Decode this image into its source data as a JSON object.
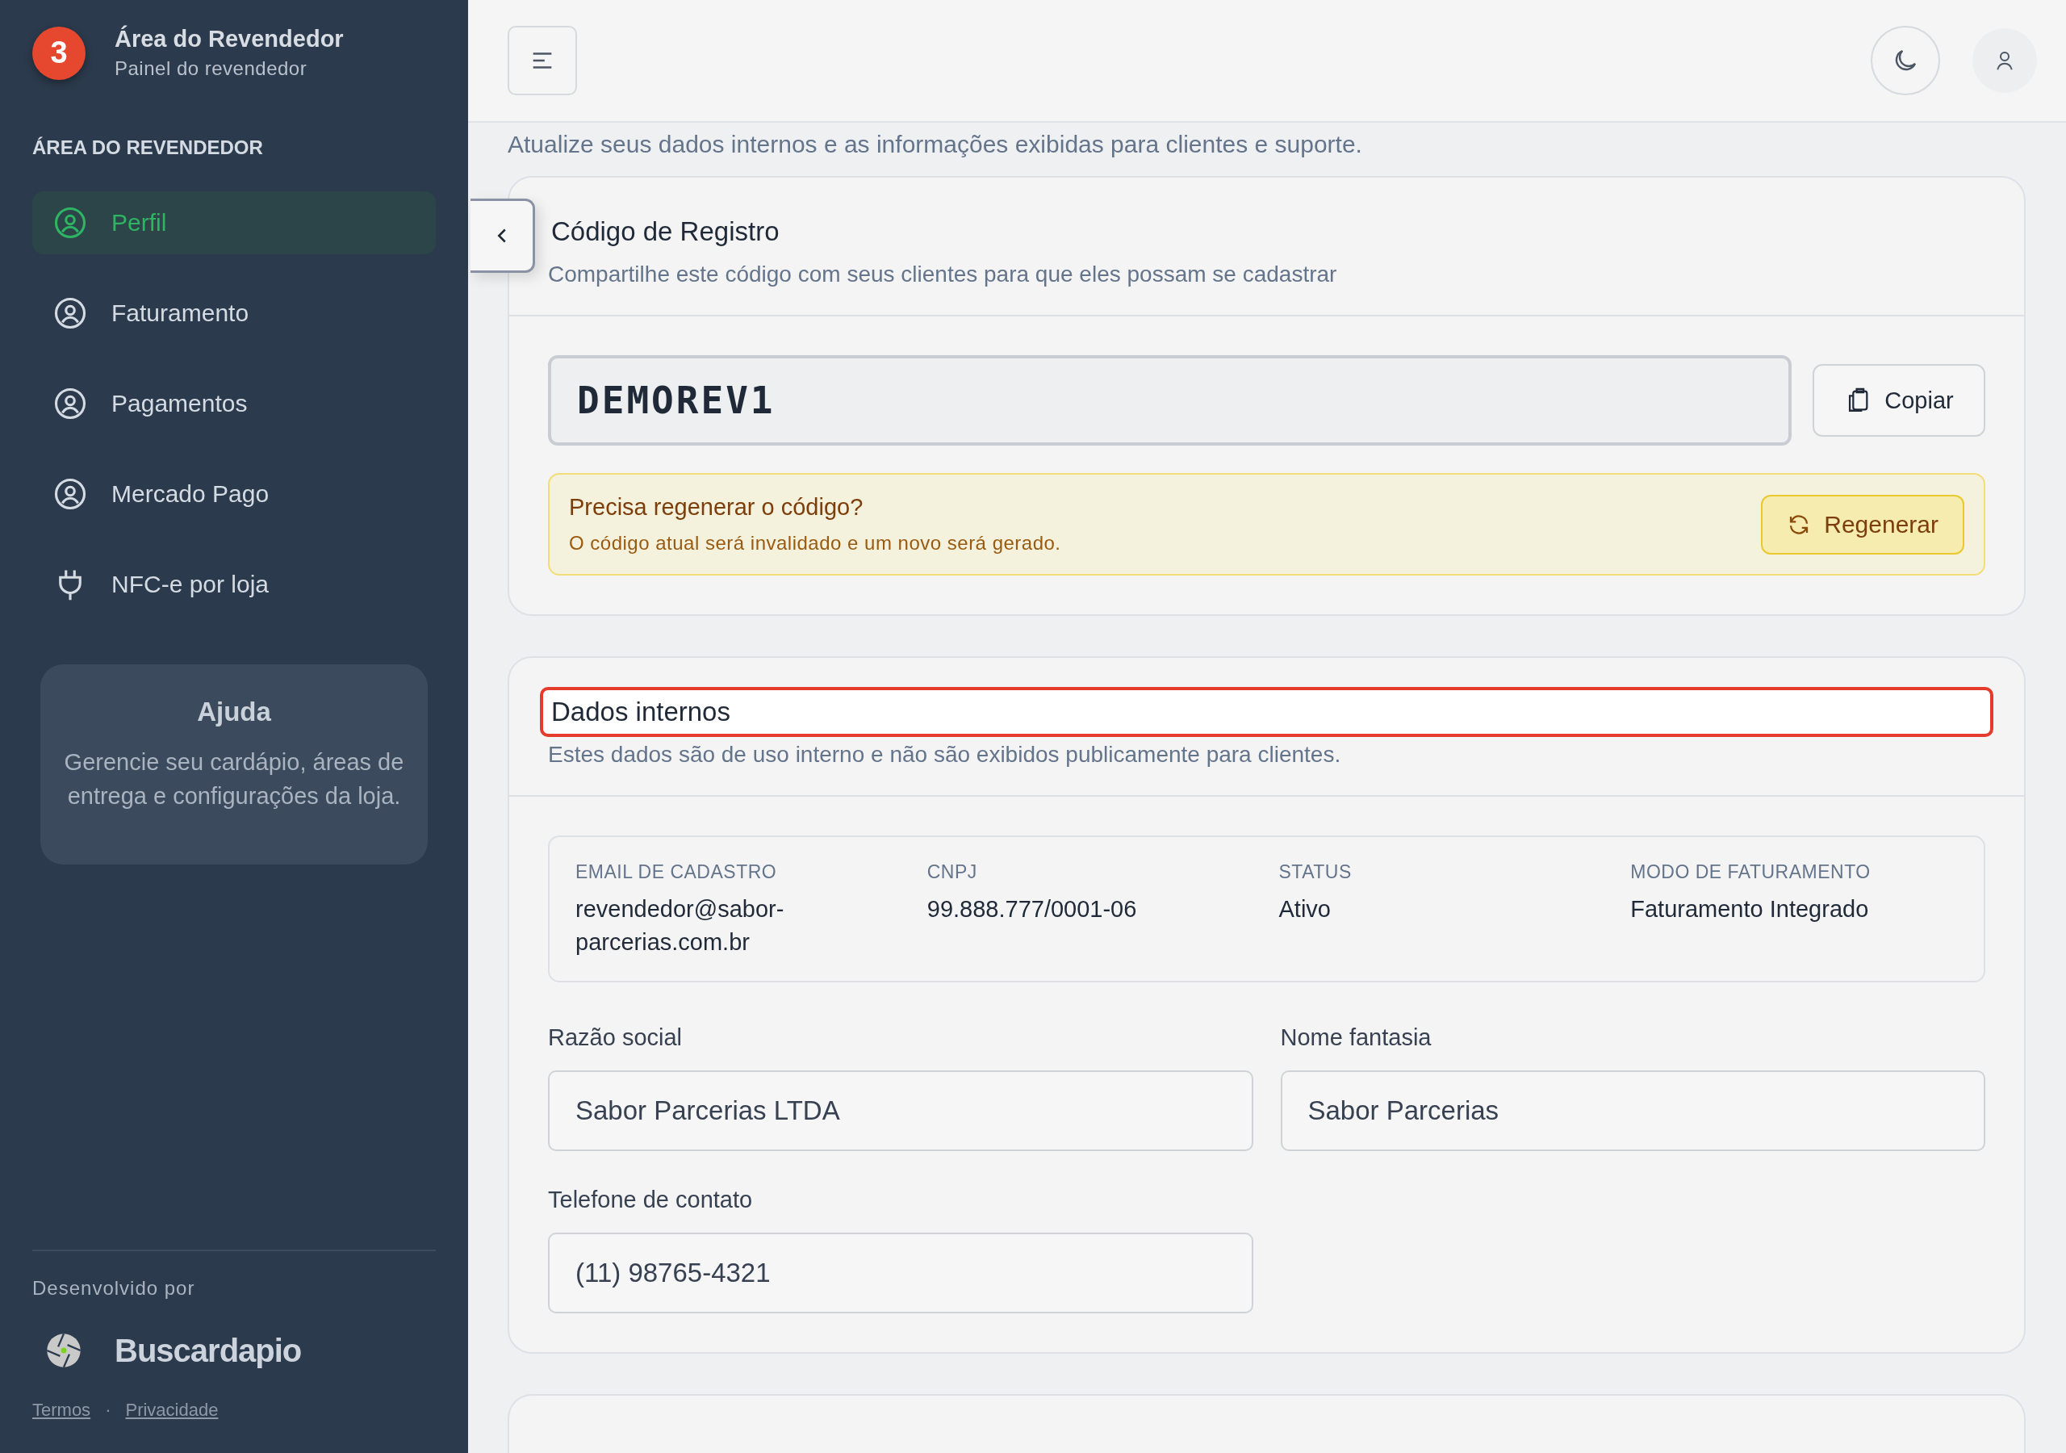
{
  "sidebar": {
    "badge": "3",
    "brand_title": "Área do Revendedor",
    "brand_subtitle": "Painel do revendedor",
    "section_label": "ÁREA DO REVENDEDOR",
    "items": [
      {
        "label": "Perfil",
        "kind": "user",
        "selected": true
      },
      {
        "label": "Faturamento",
        "kind": "user",
        "selected": false
      },
      {
        "label": "Pagamentos",
        "kind": "user",
        "selected": false
      },
      {
        "label": "Mercado Pago",
        "kind": "user",
        "selected": false
      },
      {
        "label": "NFC-e por loja",
        "kind": "plug",
        "selected": false
      }
    ],
    "help": {
      "title": "Ajuda",
      "text": "Gerencie seu cardápio, áreas de entrega e configurações da loja."
    },
    "footer": {
      "credit": "Desenvolvido por",
      "logo_text": "Buscardapio",
      "links": [
        "Termos",
        "Privacidade"
      ],
      "separator": "·"
    }
  },
  "page_subtitle": "Atualize seus dados internos e as informações exibidas para clientes e suporte.",
  "registration_card": {
    "title": "Código de Registro",
    "subtitle": "Compartilhe este código com seus clientes para que eles possam se cadastrar",
    "code": "DEMOREV1",
    "copy_button": "Copiar",
    "notice": {
      "title": "Precisa regenerar o código?",
      "text": "O código atual será invalidado e um novo será gerado.",
      "button": "Regenerar"
    }
  },
  "internal_card": {
    "title": "Dados internos",
    "highlighted": true,
    "subtitle": "Estes dados são de uso interno e não são exibidos publicamente para clientes.",
    "info": [
      {
        "label": "EMAIL DE CADASTRO",
        "value": "revendedor@sabor-parcerias.com.br"
      },
      {
        "label": "CNPJ",
        "value": "99.888.777/0001-06"
      },
      {
        "label": "STATUS",
        "value": "Ativo"
      },
      {
        "label": "MODO DE FATURAMENTO",
        "value": "Faturamento Integrado"
      }
    ],
    "fields": [
      {
        "label": "Razão social",
        "value": "Sabor Parcerias LTDA"
      },
      {
        "label": "Nome fantasia",
        "value": "Sabor Parcerias"
      },
      {
        "label": "Telefone de contato",
        "value": "(11) 98765-4321"
      }
    ]
  }
}
